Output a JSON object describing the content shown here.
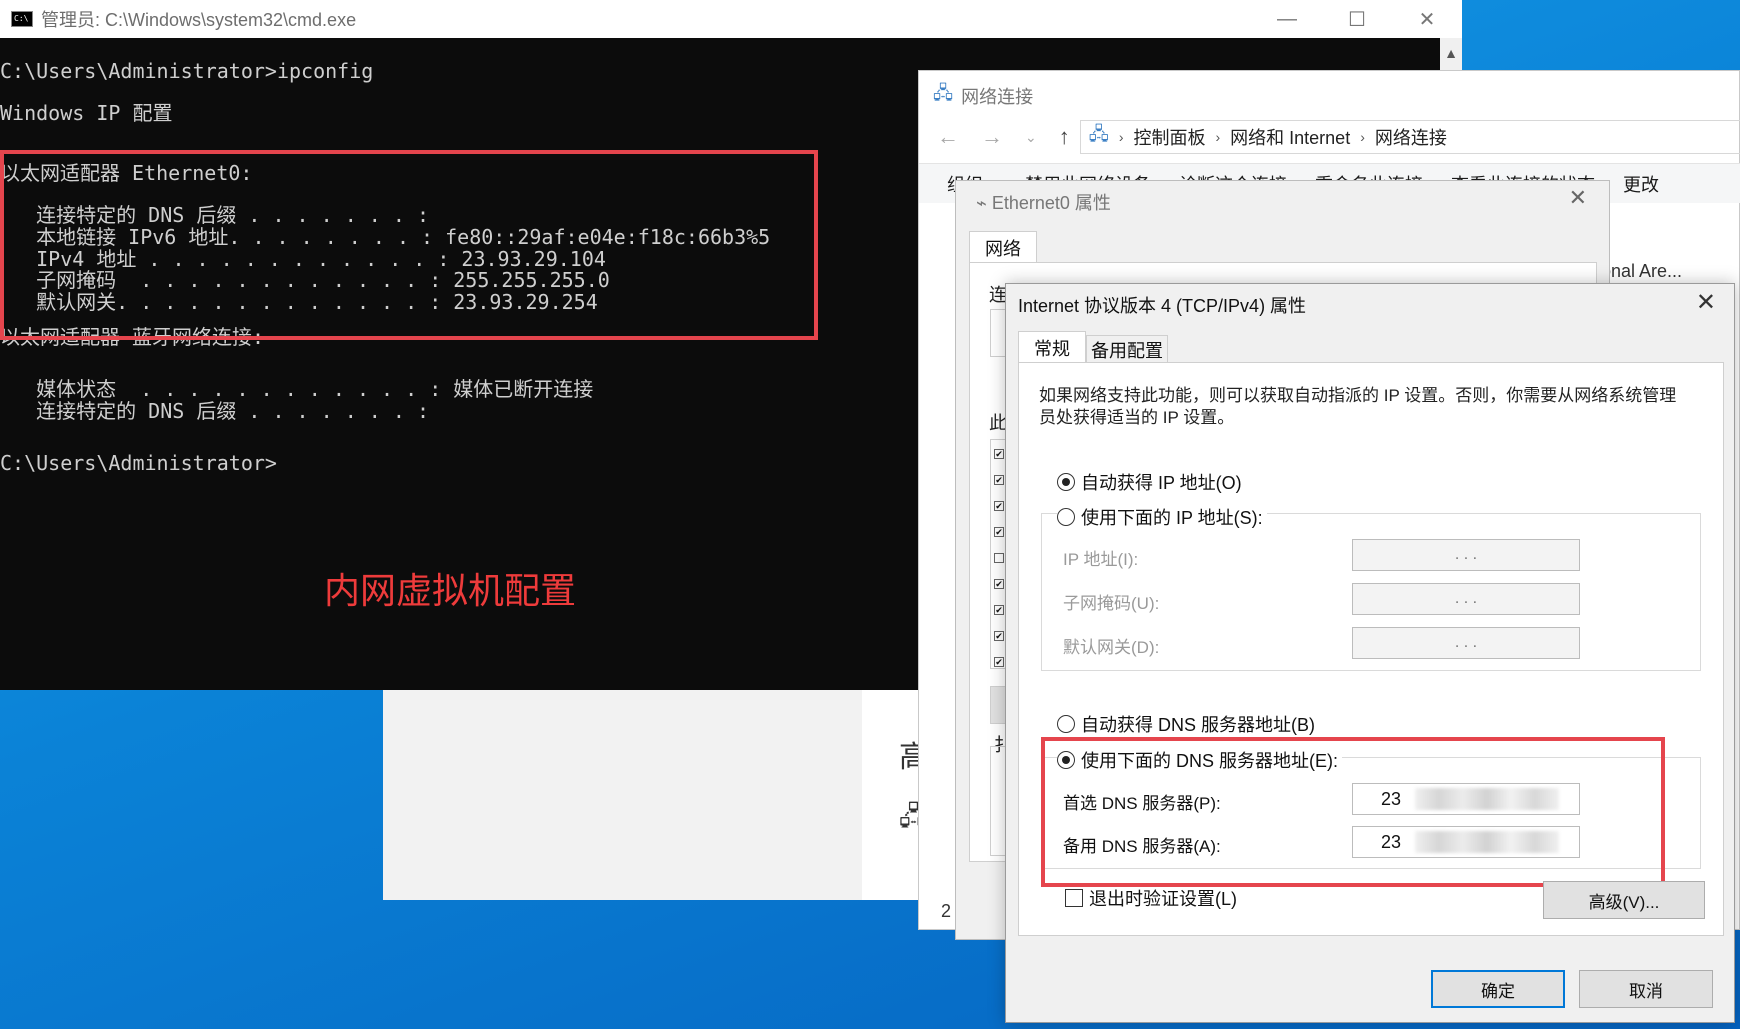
{
  "cmd": {
    "title": "管理员: C:\\Windows\\system32\\cmd.exe",
    "lines": [
      "C:\\Users\\Administrator>ipconfig",
      "Windows IP 配置",
      "以太网适配器 Ethernet0:",
      "   连接特定的 DNS 后缀 . . . . . . . :",
      "   本地链接 IPv6 地址. . . . . . . . : fe80::29af:e04e:f18c:66b3%5",
      "   IPv4 地址 . . . . . . . . . . . . : 23.93.29.104",
      "   子网掩码  . . . . . . . . . . . . : 255.255.255.0",
      "   默认网关. . . . . . . . . . . . . : 23.93.29.254",
      "以太网适配器 蓝牙网络连接:",
      "   媒体状态  . . . . . . . . . . . . : 媒体已断开连接",
      "   连接特定的 DNS 后缀 . . . . . . . :",
      "C:\\Users\\Administrator>"
    ],
    "annotation": "内网虚拟机配置"
  },
  "window_controls": {
    "minimize": "—",
    "maximize": "☐",
    "close": "✕"
  },
  "network_window": {
    "title": "网络连接",
    "breadcrumb": [
      "控制面板",
      "网络和 Internet",
      "网络连接"
    ],
    "toolbar": [
      "组织 ▾",
      "禁用此网络设备",
      "诊断这个连接",
      "重命名此连接",
      "查看此连接的状态",
      "更改"
    ],
    "behind_text": "onal Are...",
    "footer_text": "2"
  },
  "ethernet_props": {
    "title": "Ethernet0 属性",
    "tab": "网络",
    "label_connect": "连",
    "label_this": "此",
    "label_install": "扌"
  },
  "desktop": {
    "partial_text_1": "高"
  },
  "ipv4_dialog": {
    "title": "Internet 协议版本 4 (TCP/IPv4) 属性",
    "tabs": [
      "常规",
      "备用配置"
    ],
    "description": "如果网络支持此功能，则可以获取自动指派的 IP 设置。否则，你需要从网络系统管理员处获得适当的 IP 设置。",
    "auto_ip": "自动获得 IP 地址(O)",
    "manual_ip": "使用下面的 IP 地址(S):",
    "ip_label": "IP 地址(I):",
    "mask_label": "子网掩码(U):",
    "gateway_label": "默认网关(D):",
    "auto_dns": "自动获得 DNS 服务器地址(B)",
    "manual_dns": "使用下面的 DNS 服务器地址(E):",
    "preferred_dns_label": "首选 DNS 服务器(P):",
    "alternate_dns_label": "备用 DNS 服务器(A):",
    "preferred_dns_value": "23",
    "alternate_dns_value": "23",
    "validate_on_exit": "退出时验证设置(L)",
    "advanced_button": "高级(V)...",
    "ok_button": "确定",
    "cancel_button": "取消",
    "ip_dots": ".   .   ."
  }
}
